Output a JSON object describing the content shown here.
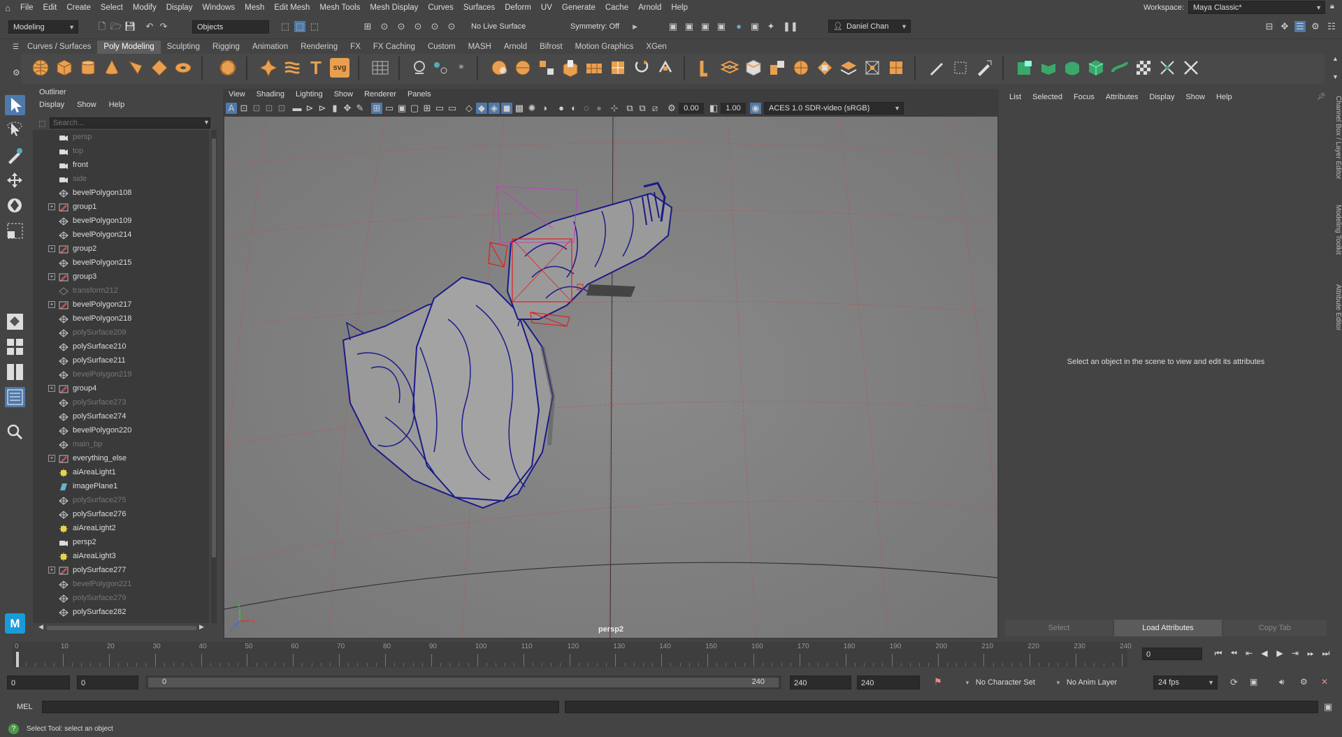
{
  "menubar": {
    "items": [
      "File",
      "Edit",
      "Create",
      "Select",
      "Modify",
      "Display",
      "Windows",
      "Mesh",
      "Edit Mesh",
      "Mesh Tools",
      "Mesh Display",
      "Curves",
      "Surfaces",
      "Deform",
      "UV",
      "Generate",
      "Cache",
      "Arnold",
      "Help"
    ],
    "workspace_label": "Workspace:",
    "workspace_value": "Maya Classic*"
  },
  "statusline": {
    "mode": "Modeling",
    "objects": "Objects",
    "live_surface": "No Live Surface",
    "symmetry": "Symmetry: Off",
    "user": "Daniel Chan"
  },
  "shelf": {
    "tabs": [
      "Curves / Surfaces",
      "Poly Modeling",
      "Sculpting",
      "Rigging",
      "Animation",
      "Rendering",
      "FX",
      "FX Caching",
      "Custom",
      "MASH",
      "Arnold",
      "Bifrost",
      "Motion Graphics",
      "XGen"
    ],
    "active_tab": "Poly Modeling",
    "svg_label": "svg",
    "text_label": "T"
  },
  "outliner": {
    "title": "Outliner",
    "menu": [
      "Display",
      "Show",
      "Help"
    ],
    "search_placeholder": "Search...",
    "items": [
      {
        "label": "persp",
        "icon": "camera-icon",
        "dim": true,
        "expand": false
      },
      {
        "label": "top",
        "icon": "camera-icon",
        "dim": true,
        "expand": false
      },
      {
        "label": "front",
        "icon": "camera-icon",
        "dim": false,
        "expand": false
      },
      {
        "label": "side",
        "icon": "camera-icon",
        "dim": true,
        "expand": false
      },
      {
        "label": "bevelPolygon108",
        "icon": "mesh-icon",
        "dim": false,
        "expand": false
      },
      {
        "label": "group1",
        "icon": "group-icon",
        "dim": false,
        "expand": true
      },
      {
        "label": "bevelPolygon109",
        "icon": "mesh-icon",
        "dim": false,
        "expand": false
      },
      {
        "label": "bevelPolygon214",
        "icon": "mesh-icon",
        "dim": false,
        "expand": false
      },
      {
        "label": "group2",
        "icon": "group-icon",
        "dim": false,
        "expand": true
      },
      {
        "label": "bevelPolygon215",
        "icon": "mesh-icon",
        "dim": false,
        "expand": false
      },
      {
        "label": "group3",
        "icon": "group-icon",
        "dim": false,
        "expand": true
      },
      {
        "label": "transform212",
        "icon": "transform-icon",
        "dim": true,
        "expand": false
      },
      {
        "label": "bevelPolygon217",
        "icon": "group-icon",
        "dim": false,
        "expand": true
      },
      {
        "label": "bevelPolygon218",
        "icon": "mesh-icon",
        "dim": false,
        "expand": false
      },
      {
        "label": "polySurface209",
        "icon": "mesh-icon",
        "dim": true,
        "expand": false
      },
      {
        "label": "polySurface210",
        "icon": "mesh-icon",
        "dim": false,
        "expand": false
      },
      {
        "label": "polySurface211",
        "icon": "mesh-icon",
        "dim": false,
        "expand": false
      },
      {
        "label": "bevelPolygon219",
        "icon": "mesh-icon",
        "dim": true,
        "expand": false
      },
      {
        "label": "group4",
        "icon": "group-icon",
        "dim": false,
        "expand": true
      },
      {
        "label": "polySurface273",
        "icon": "mesh-icon",
        "dim": true,
        "expand": false
      },
      {
        "label": "polySurface274",
        "icon": "mesh-icon",
        "dim": false,
        "expand": false
      },
      {
        "label": "bevelPolygon220",
        "icon": "mesh-icon",
        "dim": false,
        "expand": false
      },
      {
        "label": "main_bp",
        "icon": "mesh-icon",
        "dim": true,
        "expand": false
      },
      {
        "label": "everything_else",
        "icon": "group-icon",
        "dim": false,
        "expand": true
      },
      {
        "label": "aiAreaLight1",
        "icon": "light-icon",
        "dim": false,
        "expand": false
      },
      {
        "label": "imagePlane1",
        "icon": "image-plane-icon",
        "dim": false,
        "expand": false
      },
      {
        "label": "polySurface275",
        "icon": "mesh-icon",
        "dim": true,
        "expand": false
      },
      {
        "label": "polySurface276",
        "icon": "mesh-icon",
        "dim": false,
        "expand": false
      },
      {
        "label": "aiAreaLight2",
        "icon": "light-icon",
        "dim": false,
        "expand": false
      },
      {
        "label": "persp2",
        "icon": "camera-icon",
        "dim": false,
        "expand": false
      },
      {
        "label": "aiAreaLight3",
        "icon": "light-icon",
        "dim": false,
        "expand": false
      },
      {
        "label": "polySurface277",
        "icon": "group-icon",
        "dim": false,
        "expand": true
      },
      {
        "label": "bevelPolygon221",
        "icon": "mesh-icon",
        "dim": true,
        "expand": false
      },
      {
        "label": "polySurface279",
        "icon": "mesh-icon",
        "dim": true,
        "expand": false
      },
      {
        "label": "polySurface282",
        "icon": "mesh-icon",
        "dim": false,
        "expand": false
      }
    ]
  },
  "viewport": {
    "menu": [
      "View",
      "Shading",
      "Lighting",
      "Show",
      "Renderer",
      "Panels"
    ],
    "exposure": "0.00",
    "gamma": "1.00",
    "colorspace": "ACES 1.0 SDR-video (sRGB)",
    "camera": "persp2"
  },
  "attr": {
    "menu": [
      "List",
      "Selected",
      "Focus",
      "Attributes",
      "Display",
      "Show",
      "Help"
    ],
    "message": "Select an object in the scene to view and edit its attributes",
    "btn_select": "Select",
    "btn_load": "Load Attributes",
    "btn_copy": "Copy Tab"
  },
  "rightstrip": {
    "tabs": [
      "Channel Box / Layer Editor",
      "Modeling Toolkit",
      "Attribute Editor"
    ]
  },
  "timeline": {
    "start": 0,
    "end": 240,
    "major_step": 10,
    "current": "0"
  },
  "range": {
    "start": "0",
    "anim_start": "0",
    "slider_start": "0",
    "slider_end": "240",
    "end": "240",
    "anim_end": "240",
    "character_set": "No Character Set",
    "anim_layer": "No Anim Layer",
    "fps": "24 fps"
  },
  "mel": {
    "label": "MEL"
  },
  "status": {
    "message": "Select Tool: select an object"
  },
  "colors": {
    "accent": "#e8a050",
    "wire": "#1a1a8a",
    "grid": "#c84a4a",
    "select_blue": "#4f79a8"
  }
}
